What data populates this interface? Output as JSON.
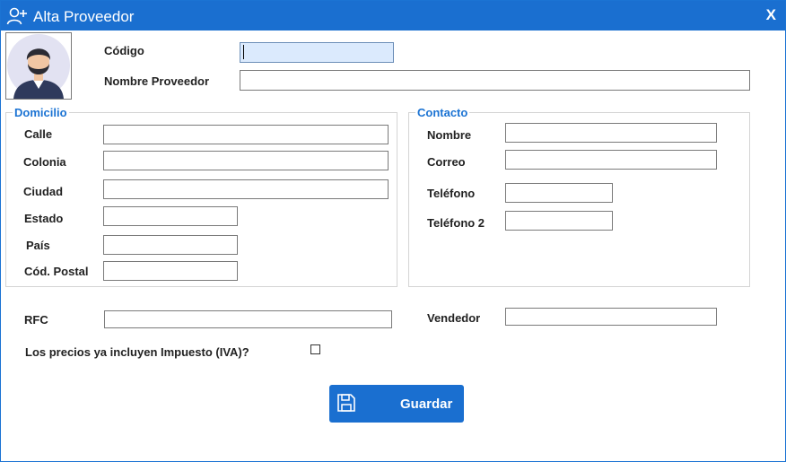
{
  "window": {
    "title": "Alta Proveedor",
    "close_label": "X"
  },
  "header": {
    "codigo_label": "Código",
    "codigo_value": "",
    "nombre_label": "Nombre Proveedor",
    "nombre_value": ""
  },
  "domicilio": {
    "legend": "Domicilio",
    "calle_label": "Calle",
    "colonia_label": "Colonia",
    "ciudad_label": "Ciudad",
    "estado_label": "Estado",
    "pais_label": "País",
    "cp_label": "Cód. Postal"
  },
  "contacto": {
    "legend": "Contacto",
    "nombre_label": "Nombre",
    "correo_label": "Correo",
    "telefono_label": "Teléfono",
    "telefono2_label": "Teléfono 2"
  },
  "extra": {
    "rfc_label": "RFC",
    "vendedor_label": "Vendedor",
    "iva_label": "Los precios ya incluyen Impuesto (IVA)?",
    "iva_checked": false
  },
  "actions": {
    "save_label": "Guardar"
  },
  "colors": {
    "accent": "#1a6fd0",
    "legend": "#1b73d3",
    "focus_field": "#dbeafd"
  },
  "icons": {
    "title": "add-user-icon",
    "avatar": "person-avatar",
    "save": "floppy-disk-icon"
  }
}
